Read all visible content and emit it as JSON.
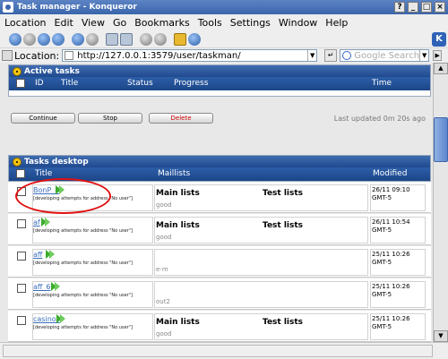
{
  "window": {
    "title": "Task manager - Konqueror",
    "btn_help": "?",
    "btn_min": "_",
    "btn_max": "□",
    "btn_close": "×"
  },
  "menu": [
    "Location",
    "Edit",
    "View",
    "Go",
    "Bookmarks",
    "Tools",
    "Settings",
    "Window",
    "Help"
  ],
  "location": {
    "label": "Location:",
    "url": "http://127.0.0.1:3579/user/taskman/",
    "search_placeholder": "Google Search"
  },
  "active_tasks": {
    "title": "Active tasks",
    "columns": {
      "id": "ID",
      "title": "Title",
      "status": "Status",
      "progress": "Progress",
      "time": "Time"
    }
  },
  "actions": {
    "continue": "Continue",
    "stop": "Stop",
    "delete": "Delete",
    "updated": "Last updated 0m 20s ago",
    "delete_color": "#cc0000"
  },
  "desktop": {
    "title": "Tasks desktop",
    "columns": {
      "title": "Title",
      "maillists": "Maillists",
      "modified": "Modified"
    },
    "rows": [
      {
        "title": "BonP_8",
        "note": "[developing attempts for address \"No user\"]",
        "ml1": "Main lists",
        "ml2": "Test lists",
        "ml_sub": "good",
        "modified": "26/11 09:10 GMT-5"
      },
      {
        "title": "af",
        "note": "[developing attempts for address \"No user\"]",
        "ml1": "Main lists",
        "ml2": "Test lists",
        "ml_sub": "good",
        "modified": "26/11 10:54 GMT-5"
      },
      {
        "title": "aff",
        "note": "[developing attempts for address \"No user\"]",
        "ml1": "",
        "ml2": "",
        "ml_sub": "e-m",
        "modified": "25/11 10:26 GMT-5"
      },
      {
        "title": "aff_6",
        "note": "[developing attempts for address \"No user\"]",
        "ml1": "",
        "ml2": "",
        "ml_sub": "out2",
        "modified": "25/11 10:26 GMT-5"
      },
      {
        "title": "casinos",
        "note": "[developing attempts for address \"No user\"]",
        "ml1": "Main lists",
        "ml2": "Test lists",
        "ml_sub": "good",
        "modified": "25/11 10:26 GMT-5"
      }
    ]
  },
  "colors": {
    "panel_header": "#2c5ea8",
    "link": "#3b6ebd",
    "annotation": "#e21010",
    "play": "#3cab2c"
  }
}
